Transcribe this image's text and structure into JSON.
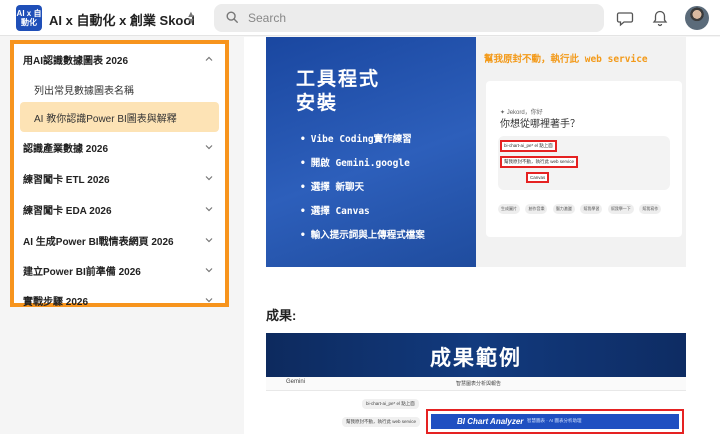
{
  "header": {
    "logo_text": "AI x 自動化",
    "brand": "AI x 自動化 x 創業 Skool",
    "search_placeholder": "Search"
  },
  "sidebar": {
    "items": [
      {
        "label": "用AI認識數據圖表 2026",
        "type": "section",
        "expanded": true
      },
      {
        "label": "列出常見數據圖表名稱",
        "type": "sub"
      },
      {
        "label": "AI 教你認識Power BI圖表與解釋",
        "type": "sub",
        "active": true
      },
      {
        "label": "認識產業數據 2026",
        "type": "section"
      },
      {
        "label": "練習闖卡 ETL 2026",
        "type": "section"
      },
      {
        "label": "練習闖卡 EDA 2026",
        "type": "section"
      },
      {
        "label": "AI 生成Power BI戰情表網頁 2026",
        "type": "section"
      },
      {
        "label": "建立Power BI前準備 2026",
        "type": "section"
      },
      {
        "label": "實戰步驟 2026",
        "type": "section"
      }
    ]
  },
  "slide": {
    "title": "工具程式\n安裝",
    "note": "幫我原封不動，執行此 web service",
    "bullets": [
      "Vibe Coding實作練習",
      "開啟 Gemini.google",
      "選擇 新聊天",
      "選擇 Canvas",
      "輸入提示詞與上傳程式檔案"
    ],
    "mock": {
      "greeting": "✦ Jekord，你好",
      "title": "你想從哪裡著手？",
      "highlights": [
        "bi-chart-ai_pe* el 點上面",
        "幫我原封不動，執行此 web service",
        "Canvas"
      ],
      "chips": [
        "生成圖片",
        "創作音樂",
        "腦力激盪",
        "幫我學習",
        "幫我學一下",
        "幫我寫作"
      ]
    }
  },
  "result": {
    "heading": "成果:",
    "banner": "成果範例",
    "gemini_label": "Gemini",
    "window_title": "智慧圖表分析與報告",
    "bubble_1": "bi-chart-ai_pe* el 點上面",
    "bubble_2": "幫我原封不動，執行此 web service",
    "analyzer_title": "BI Chart Analyzer",
    "analyzer_sub": "智慧圖表 · AI 圖表分析助理"
  },
  "colors": {
    "accent_border": "#f7941d",
    "active_item_bg": "#fde3b5",
    "slide_blue": "#1a47a0",
    "highlight_red": "#e52222"
  }
}
